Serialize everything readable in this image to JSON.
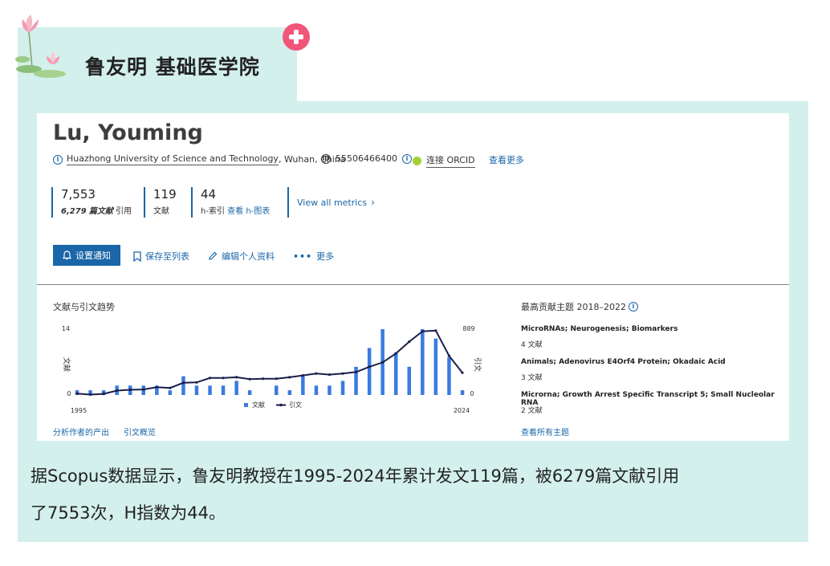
{
  "header": {
    "title": "鲁友明 基础医学院"
  },
  "profile": {
    "name": "Lu, Youming",
    "affiliation": "Huazhong University of Science and Technology",
    "location": ", Wuhan, China",
    "scopus_id": "55506466400",
    "orcid_label": "连接 ORCID",
    "more_label": "查看更多"
  },
  "metrics": {
    "citations": "7,553",
    "citations_sub_count": "6,279",
    "citations_sub_unit": "篇文献",
    "citations_sub_label": "引用",
    "documents": "119",
    "documents_label": "文献",
    "h_index": "44",
    "h_index_label": "h-索引",
    "h_view_label": "查看",
    "h_chart_label": "h-图表",
    "view_all": "View all metrics"
  },
  "actions": {
    "notify": "设置通知",
    "save": "保存至列表",
    "edit": "编辑个人资料",
    "more": "更多"
  },
  "trend": {
    "title": "文献与引文趋势",
    "analyze_link": "分析作者的产出",
    "citation_overview_link": "引文概览"
  },
  "chart_data": {
    "type": "bar",
    "x": [
      1995,
      1996,
      1997,
      1998,
      1999,
      2000,
      2001,
      2002,
      2003,
      2004,
      2005,
      2006,
      2007,
      2008,
      2009,
      2010,
      2011,
      2012,
      2013,
      2014,
      2015,
      2016,
      2017,
      2018,
      2019,
      2020,
      2021,
      2022,
      2023,
      2024
    ],
    "series": [
      {
        "name": "文献",
        "kind": "bar",
        "axis": "left",
        "values": [
          1,
          1,
          1,
          2,
          2,
          2,
          2,
          1,
          4,
          2,
          2,
          2,
          3,
          1,
          0,
          2,
          1,
          4,
          2,
          2,
          3,
          6,
          10,
          14,
          9,
          6,
          14,
          12,
          8,
          1
        ]
      },
      {
        "name": "引文",
        "kind": "line",
        "axis": "right",
        "values": [
          20,
          5,
          15,
          60,
          70,
          75,
          105,
          95,
          165,
          170,
          230,
          230,
          240,
          215,
          220,
          220,
          240,
          265,
          290,
          275,
          290,
          310,
          380,
          440,
          560,
          720,
          860,
          870,
          530,
          300
        ]
      }
    ],
    "xlabel": "",
    "ylabel": "文献",
    "y2label": "引文",
    "ylim": [
      0,
      14
    ],
    "y2lim": [
      0,
      889
    ],
    "x_tick_labels": [
      "1995",
      "2024"
    ],
    "y_tick_labels": [
      "14",
      "0"
    ],
    "y2_tick_labels": [
      "889",
      "0"
    ],
    "legend_position": "bottom-center",
    "bar_color": "#3a7be0",
    "line_color": "#1b1f4b"
  },
  "topics": {
    "title": "最高贡献主题 2018–2022",
    "items": [
      {
        "name": "MicroRNAs; Neurogenesis; Biomarkers",
        "count": "4 文献"
      },
      {
        "name": "Animals; Adenovirus E4Orf4 Protein; Okadaic Acid",
        "count": "3 文献"
      },
      {
        "name": "Microrna; Growth Arrest Specific Transcript 5; Small Nucleolar RNA",
        "count": "2 文献"
      }
    ],
    "all_link": "查看所有主题"
  },
  "caption": {
    "line1": "据Scopus数据显示，鲁友明教授在1995-2024年累计发文119篇，被6279篇文献引用",
    "line2": "了7553次，H指数为44。"
  },
  "colors": {
    "band": "#d3f0ec",
    "accent": "#1a66a8",
    "badge": "#f2557a"
  }
}
